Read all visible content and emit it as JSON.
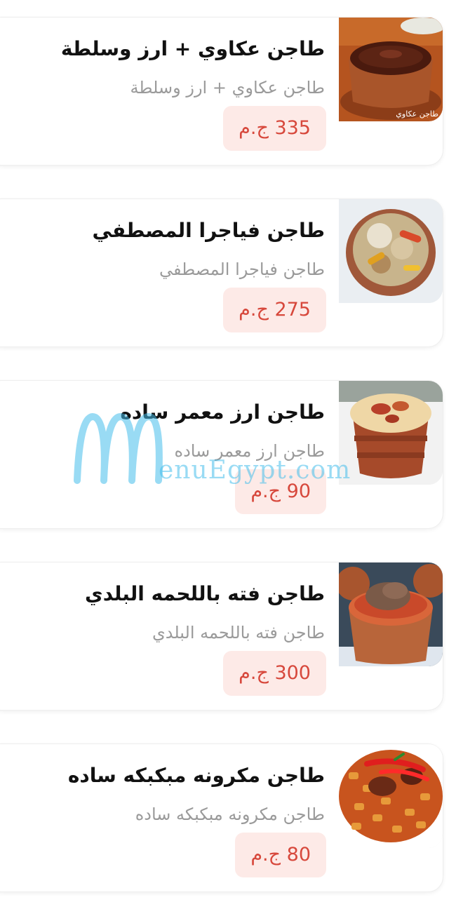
{
  "menu": {
    "items": [
      {
        "name": "طاجن عكاوي + ارز وسلطة",
        "description": "طاجن عكاوي + ارز وسلطة",
        "price": "335 ج.م",
        "photo_caption": "طاجن عكاوي"
      },
      {
        "name": "طاجن فياجرا المصطفي",
        "description": "طاجن فياجرا المصطفي",
        "price": "275 ج.م"
      },
      {
        "name": "طاجن ارز معمر ساده",
        "description": "طاجن ارز معمر ساده",
        "price": "90 ج.م"
      },
      {
        "name": "طاجن فته باللحمه البلدي",
        "description": "طاجن فته باللحمه البلدي",
        "price": "300 ج.م"
      },
      {
        "name": "طاجن مكرونه مبكبكه ساده",
        "description": "طاجن مكرونه مبكبكه ساده",
        "price": "80 ج.م"
      }
    ]
  },
  "watermark": {
    "text": "enuEgypt.com"
  },
  "colors": {
    "price_text": "#d7483c",
    "price_bg": "#fdeae7",
    "watermark": "#46beeb"
  }
}
